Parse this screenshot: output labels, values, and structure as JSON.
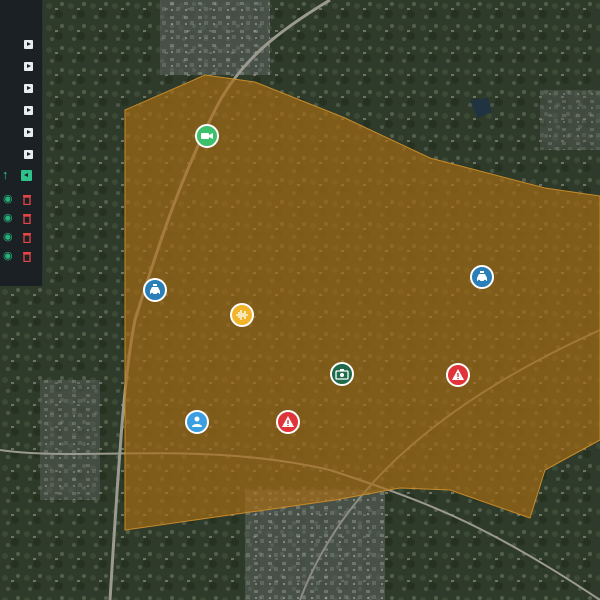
{
  "map": {
    "zone_color": "#a86d14",
    "zone_opacity": 0.68
  },
  "sidebar": {
    "layer_buttons": [
      "play-icon",
      "play-icon",
      "play-icon",
      "play-icon",
      "play-icon",
      "play-icon"
    ],
    "controls": {
      "arrow": "up-arrow-icon",
      "toggle": "play-icon"
    },
    "layers": [
      {
        "visible_icon": "eye-icon",
        "delete_icon": "trash-icon"
      },
      {
        "visible_icon": "eye-icon",
        "delete_icon": "trash-icon"
      },
      {
        "visible_icon": "eye-icon",
        "delete_icon": "trash-icon"
      },
      {
        "visible_icon": "eye-icon",
        "delete_icon": "trash-icon"
      }
    ]
  },
  "markers": [
    {
      "icon": "video-camera-icon",
      "color": "#3cc06a"
    },
    {
      "icon": "police-car-icon",
      "color": "#2b7fb8"
    },
    {
      "icon": "audio-wave-icon",
      "color": "#f2b52a"
    },
    {
      "icon": "police-car-icon",
      "color": "#2b7fb8"
    },
    {
      "icon": "camera-icon",
      "color": "#1f6a4a"
    },
    {
      "icon": "warning-icon",
      "color": "#e0343a"
    },
    {
      "icon": "person-icon",
      "color": "#3a9ee0"
    },
    {
      "icon": "warning-icon",
      "color": "#e0343a"
    }
  ]
}
